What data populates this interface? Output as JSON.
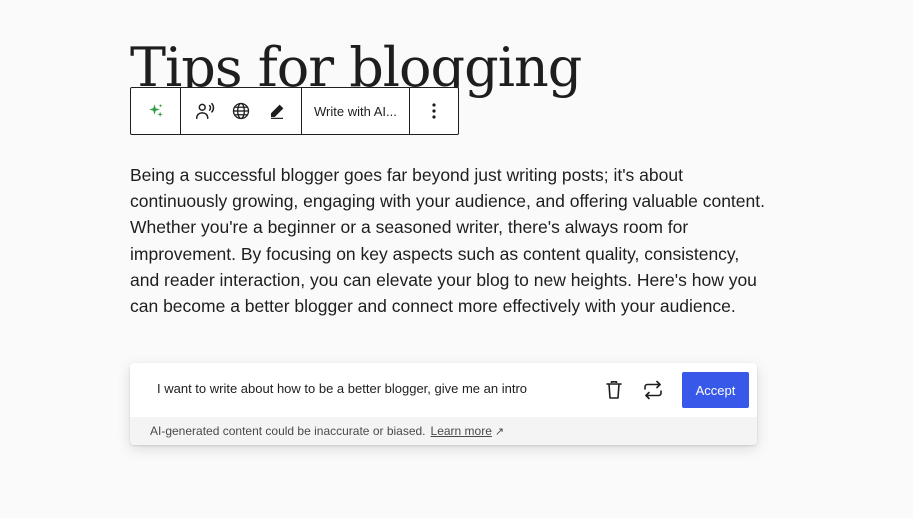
{
  "post": {
    "title": "Tips for blogging",
    "paragraph": "Being a successful blogger goes far beyond just writing posts; it's about continuously growing, engaging with your audience, and offering valuable content. Whether you're a beginner or a seasoned writer, there's always room for improvement. By focusing on key aspects such as content quality, consistency, and reader interaction, you can elevate your blog to new heights. Here's how you can become a better blogger and connect more effectively with your audience."
  },
  "toolbar": {
    "ai_icon": "sparkles-icon",
    "tools": [
      {
        "icon": "text-to-speech-icon"
      },
      {
        "icon": "globe-icon"
      },
      {
        "icon": "pencil-icon"
      }
    ],
    "write_label": "Write with AI...",
    "more_icon": "more-vertical-icon"
  },
  "ai_panel": {
    "prompt": "I want to write about how to be a better blogger, give me an intro",
    "trash_icon": "trash-icon",
    "regenerate_icon": "regenerate-icon",
    "accept_label": "Accept",
    "disclaimer": "AI-generated content could be inaccurate or biased.",
    "learn_more": "Learn more",
    "learn_more_icon": "external-arrow-icon"
  },
  "colors": {
    "accent": "#3858e9",
    "sparkle": "#2f9e44",
    "text": "#1e1e1e",
    "background": "#fafafa"
  }
}
